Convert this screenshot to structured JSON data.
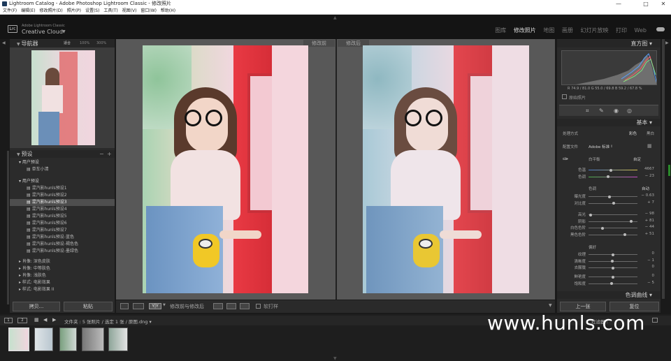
{
  "titlebar": {
    "title": "Lightroom Catalog - Adobe Photoshop Lightroom Classic - 修改照片",
    "min": "—",
    "max": "□",
    "close": "✕"
  },
  "menu": [
    "文件(F)",
    "编辑(E)",
    "修改照片(D)",
    "照片(P)",
    "设置(S)",
    "工具(T)",
    "视图(V)",
    "窗口(W)",
    "帮助(H)"
  ],
  "brand": {
    "badge": "Lrc",
    "line1": "Adobe Lightroom Classic",
    "line2": "Creative Cloud"
  },
  "modules": [
    "图库",
    "修改照片",
    "地图",
    "画册",
    "幻灯片放映",
    "打印",
    "Web"
  ],
  "navigator": {
    "title": "导航器",
    "opts": [
      "适合",
      "100%",
      "300%"
    ]
  },
  "presets": {
    "title": "预设",
    "groups": [
      {
        "name": "用户预设",
        "items": [
          "单车小清"
        ]
      },
      {
        "name": "用户预设",
        "items": [
          "混汽影hunls预设1",
          "混汽影hunls预设2",
          "混汽影hunls预设3",
          "混汽影hunls预设4",
          "混汽影hunls预设5",
          "混汽影hunls预设6",
          "混汽影hunls预设7",
          "混汽影hunls预设-蓝色",
          "混汽影hunls预设-褐色色",
          "混汽影hunls预设-墨绿色"
        ]
      }
    ],
    "more": [
      "肖像: 深色皮肤",
      "肖像: 中等肤色",
      "肖像: 浅肤色",
      "样式: 电影效果",
      "样式: 电影效果 II"
    ],
    "copy": "拷贝...",
    "paste": "粘贴"
  },
  "compare": {
    "before": "修改前",
    "after": "修改后"
  },
  "toolbar": {
    "yy": "Y|Y",
    "label": "修改前与修改后",
    "softproof": "软打样"
  },
  "histogram": {
    "title": "直方图",
    "readout": "R  74.9 / 81.0  G  55.0 / 69.8  B  59.2 / 67.8  %",
    "orig": "原始照片"
  },
  "basic": {
    "title": "基本",
    "process_label": "处理方式",
    "color": "彩色",
    "bw": "黑白",
    "profile_label": "配置文件",
    "profile": "Adobe 标准",
    "wb_label": "白平衡",
    "wb": "自定",
    "sliders1": [
      {
        "name": "色温",
        "value": "4667",
        "pos": 0.45
      },
      {
        "name": "色调",
        "value": "− 23",
        "pos": 0.4
      }
    ],
    "tone_label": "色调",
    "auto": "自动",
    "sliders2": [
      {
        "name": "曝光度",
        "value": "− 0.63",
        "pos": 0.42
      },
      {
        "name": "对比度",
        "value": "+ 7",
        "pos": 0.52
      }
    ],
    "sliders3": [
      {
        "name": "高光",
        "value": "− 98",
        "pos": 0.02
      },
      {
        "name": "阴影",
        "value": "+ 81",
        "pos": 0.9
      },
      {
        "name": "白色色阶",
        "value": "− 44",
        "pos": 0.28
      },
      {
        "name": "黑色色阶",
        "value": "+ 51",
        "pos": 0.75
      }
    ],
    "presence_label": "偏好",
    "sliders4": [
      {
        "name": "纹理",
        "value": "0",
        "pos": 0.5
      },
      {
        "name": "清晰度",
        "value": "− 1",
        "pos": 0.49
      },
      {
        "name": "去朦胧",
        "value": "0",
        "pos": 0.5
      }
    ],
    "sliders5": [
      {
        "name": "鲜艳度",
        "value": "0",
        "pos": 0.5
      },
      {
        "name": "饱和度",
        "value": "− 5",
        "pos": 0.47
      }
    ]
  },
  "tonecurve": {
    "title": "色调曲线"
  },
  "buttons": {
    "prev": "上一张",
    "reset": "复位"
  },
  "filmstrip": {
    "info": "文件夹 :  5 张照片 / 选定 1 张 / 原图.dng ▾",
    "filter": "过滤器 :"
  },
  "watermark": "www.hunls.com"
}
